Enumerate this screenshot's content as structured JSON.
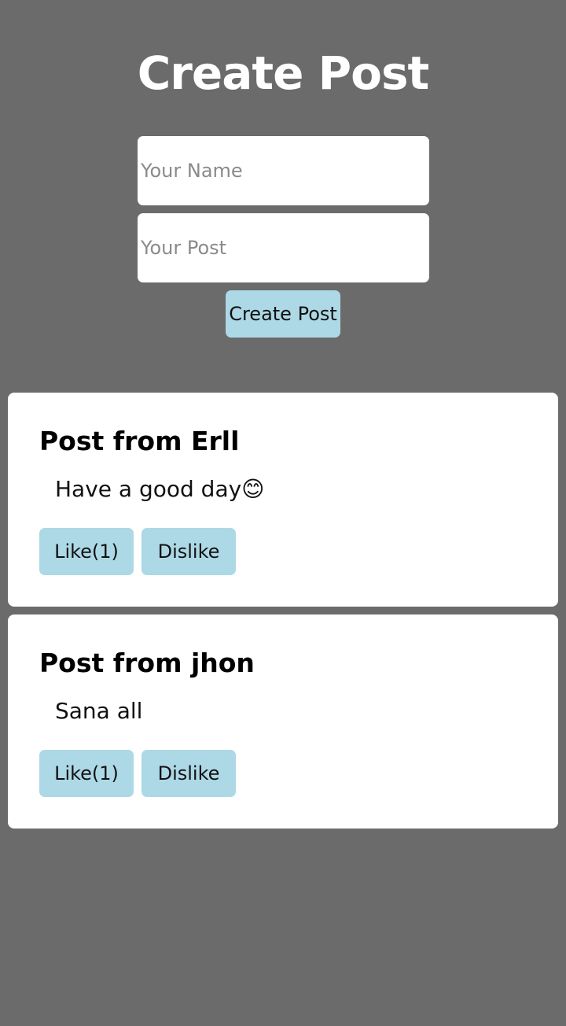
{
  "header": {
    "title": "Create Post"
  },
  "form": {
    "name_placeholder": "Your Name",
    "name_value": "",
    "post_placeholder": "Your Post",
    "post_value": "",
    "submit_label": "Create Post"
  },
  "posts": [
    {
      "heading": "Post from Erll",
      "body": "Have a good day😊",
      "like_label": "Like(1)",
      "dislike_label": "Dislike"
    },
    {
      "heading": "Post from jhon",
      "body": "Sana all",
      "like_label": "Like(1)",
      "dislike_label": "Dislike"
    }
  ],
  "colors": {
    "background": "#6b6b6b",
    "button": "#add8e6",
    "card": "#ffffff"
  }
}
